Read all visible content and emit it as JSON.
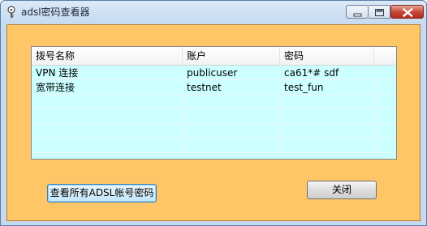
{
  "window": {
    "title": "adsl密码查看器"
  },
  "list": {
    "columns": [
      "拨号名称",
      "账户",
      "密码"
    ],
    "rows": [
      [
        "VPN 连接",
        "publicuser",
        "ca61*# sdf"
      ],
      [
        "宽带连接",
        "testnet",
        "test_fun"
      ]
    ]
  },
  "buttons": {
    "view_all": "查看所有ADSL帐号密码",
    "close": "关闭"
  }
}
